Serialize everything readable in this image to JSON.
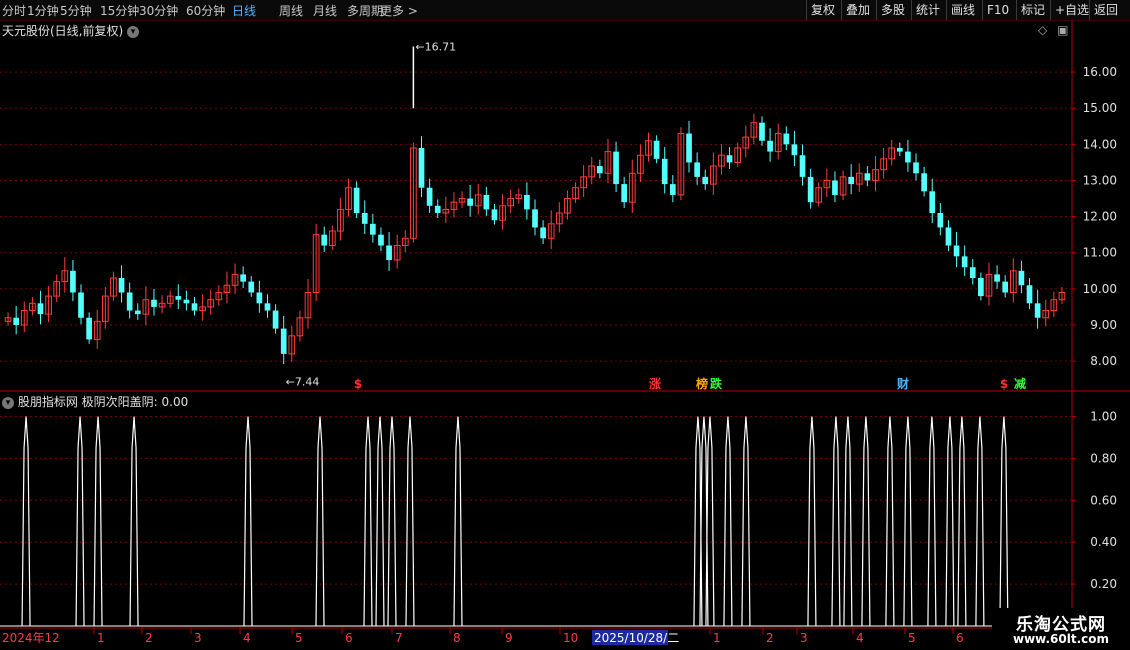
{
  "toolbar": {
    "periods": [
      "分时",
      "1分钟",
      "5分钟",
      "15分钟",
      "30分钟",
      "60分钟",
      "日线",
      "周线",
      "月线",
      "多周期",
      "更多 >"
    ],
    "active_index": 6,
    "right_buttons": [
      "复权",
      "叠加",
      "多股",
      "统计",
      "画线",
      "F10",
      "标记",
      "+自选",
      "返回"
    ]
  },
  "main_title": "天元股份(日线,前复权)",
  "indicator_title": "股朋指标网",
  "indicator_value_label": "极阴次阳盖阴: 0.00",
  "markers": [
    {
      "text": "$",
      "color": "#ff3030"
    },
    {
      "text": "涨",
      "color": "#ff3030"
    },
    {
      "text": "榜",
      "color": "#ffaa00"
    },
    {
      "text": "跌",
      "color": "#30ff30"
    },
    {
      "text": "财",
      "color": "#4fb3ff"
    },
    {
      "text": "$",
      "color": "#ff3030"
    },
    {
      "text": "减",
      "color": "#30ff30"
    }
  ],
  "x_axis_labels": [
    "2024年12",
    "1",
    "2",
    "3",
    "4",
    "5",
    "6",
    "7",
    "8",
    "9",
    "10",
    "2025/10/28/二",
    "1",
    "2",
    "3",
    "4",
    "5",
    "6"
  ],
  "watermark": {
    "line1": "乐淘公式网",
    "line2": "www.60lt.com"
  },
  "colors": {
    "up": "#ff3c3c",
    "down": "#54ffff",
    "grid": "#7a0000",
    "axis": "#b00000",
    "text": "#c8c8c8",
    "active": "#4fb3ff"
  },
  "chart_data": [
    {
      "type": "candlestick",
      "title": "天元股份(日线,前复权)",
      "y_ticks": [
        8.0,
        9.0,
        10.0,
        11.0,
        12.0,
        13.0,
        14.0,
        15.0,
        16.0
      ],
      "ylim": [
        7.2,
        17.0
      ],
      "high_label": "16.71",
      "low_label": "7.44",
      "close_path": [
        9.2,
        9.0,
        9.4,
        9.6,
        9.3,
        9.8,
        10.2,
        10.5,
        9.9,
        9.2,
        8.6,
        9.1,
        9.8,
        10.3,
        9.9,
        9.4,
        9.3,
        9.7,
        9.5,
        9.6,
        9.8,
        9.7,
        9.6,
        9.4,
        9.5,
        9.7,
        9.9,
        10.1,
        10.4,
        10.2,
        9.9,
        9.6,
        9.4,
        8.9,
        8.2,
        8.7,
        9.2,
        9.9,
        11.5,
        11.2,
        11.6,
        12.2,
        12.8,
        12.1,
        11.8,
        11.5,
        11.2,
        10.8,
        11.2,
        11.4,
        13.9,
        12.8,
        12.3,
        12.1,
        12.2,
        12.4,
        12.5,
        12.3,
        12.6,
        12.2,
        11.9,
        12.3,
        12.5,
        12.6,
        12.2,
        11.7,
        11.4,
        11.8,
        12.1,
        12.5,
        12.8,
        13.1,
        13.4,
        13.2,
        13.8,
        12.9,
        12.4,
        13.2,
        13.7,
        14.1,
        13.6,
        12.9,
        12.6,
        14.3,
        13.5,
        13.1,
        12.9,
        13.4,
        13.7,
        13.5,
        13.9,
        14.2,
        14.6,
        14.1,
        13.8,
        14.3,
        14.0,
        13.7,
        13.1,
        12.4,
        12.8,
        13.0,
        12.6,
        13.1,
        12.9,
        13.2,
        13.0,
        13.3,
        13.6,
        13.9,
        13.8,
        13.5,
        13.2,
        12.7,
        12.1,
        11.7,
        11.2,
        10.9,
        10.6,
        10.3,
        9.8,
        10.4,
        10.2,
        9.9,
        10.5,
        10.1,
        9.6,
        9.2,
        9.4,
        9.7,
        9.9
      ],
      "indicator": {
        "name": "极阴次阳盖阴",
        "y_ticks": [
          0.2,
          0.4,
          0.6,
          0.8,
          1.0
        ],
        "ylim": [
          0,
          1.05
        ],
        "signal_bars": [
          3,
          12,
          15,
          21,
          40,
          52,
          60,
          62,
          64,
          67,
          75,
          115,
          116,
          117,
          120,
          123,
          134,
          138,
          140,
          143,
          147,
          150,
          154,
          157,
          159,
          162,
          166,
          178,
          180,
          182
        ],
        "current": 0.0
      }
    }
  ]
}
